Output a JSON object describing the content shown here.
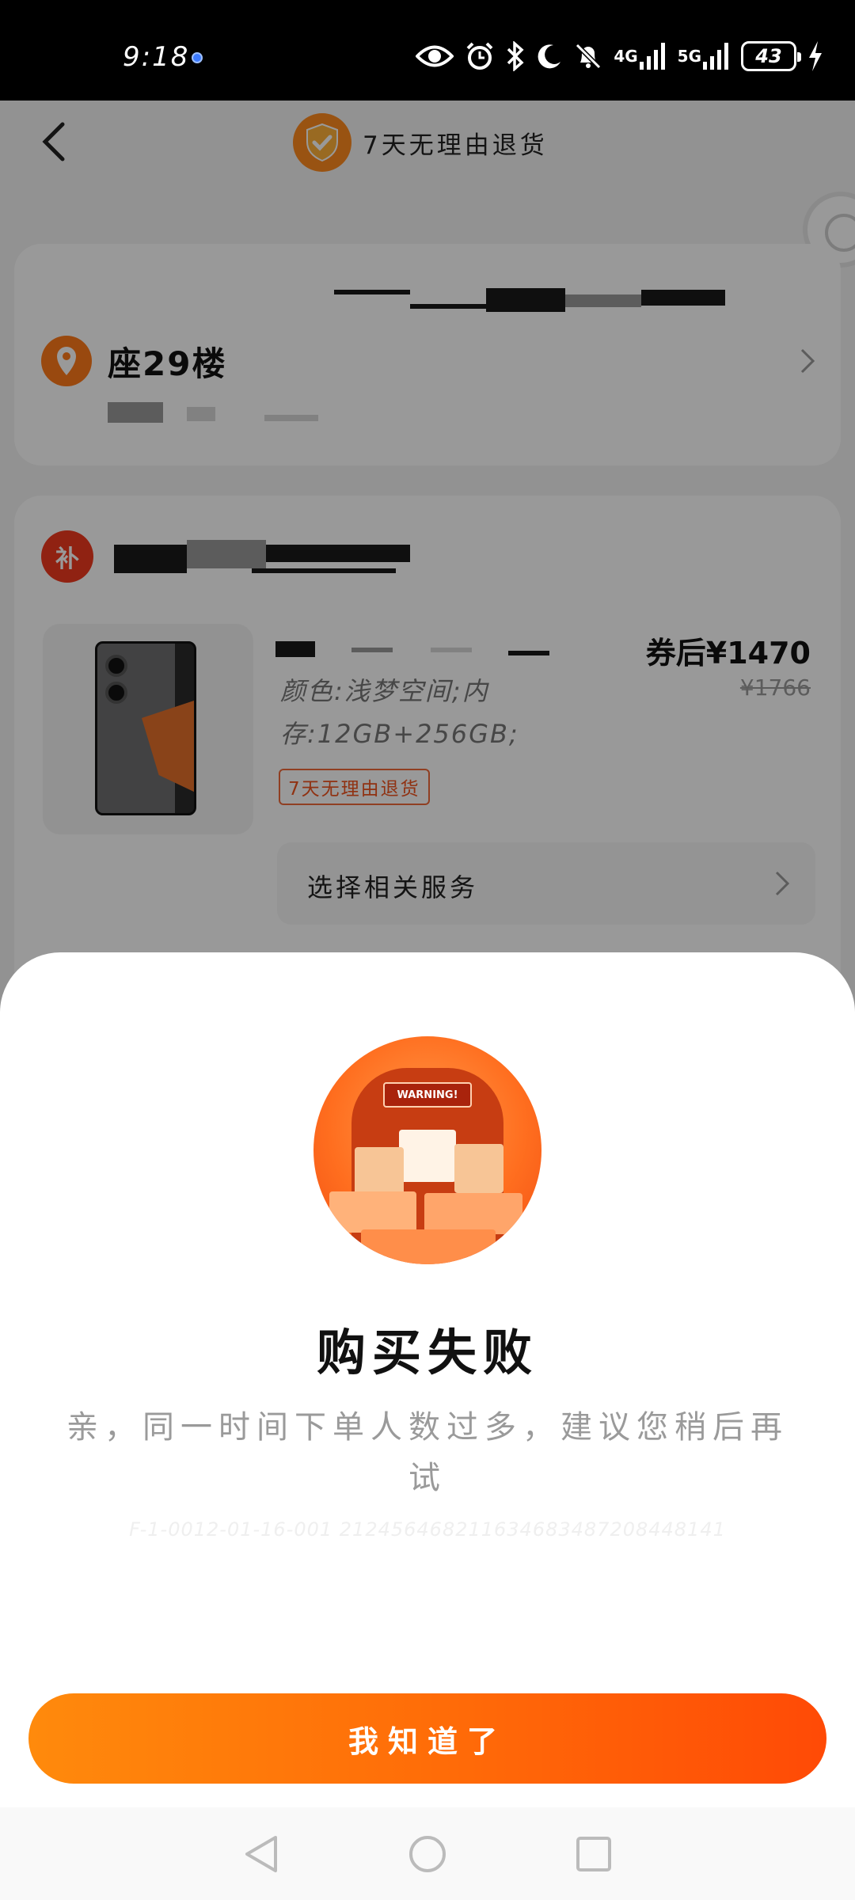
{
  "status_bar": {
    "time": "9:18",
    "net_4g": "4G",
    "net_5g": "5G",
    "battery": "43"
  },
  "header": {
    "title": "7天无理由退货"
  },
  "address": {
    "line": "座29楼"
  },
  "product": {
    "shop_badge": "补",
    "spec_line1": "颜色:浅梦空间;内",
    "spec_line2": "存:12GB+256GB;",
    "return_tag": "7天无理由退货",
    "price_after_coupon": "券后¥1470",
    "price_original": "¥1766",
    "service_label": "选择相关服务"
  },
  "dialog": {
    "illustration_sign": "WARNING!",
    "title": "购买失败",
    "message": "亲，同一时间下单人数过多，建议您稍后再试",
    "code": "F-1-0012-01-16-001 212456468211634683487208448141",
    "confirm_label": "我知道了"
  },
  "colors": {
    "accent": "#ff6a08",
    "price_tag": "#f0541e",
    "shop_badge": "#f0391e"
  }
}
